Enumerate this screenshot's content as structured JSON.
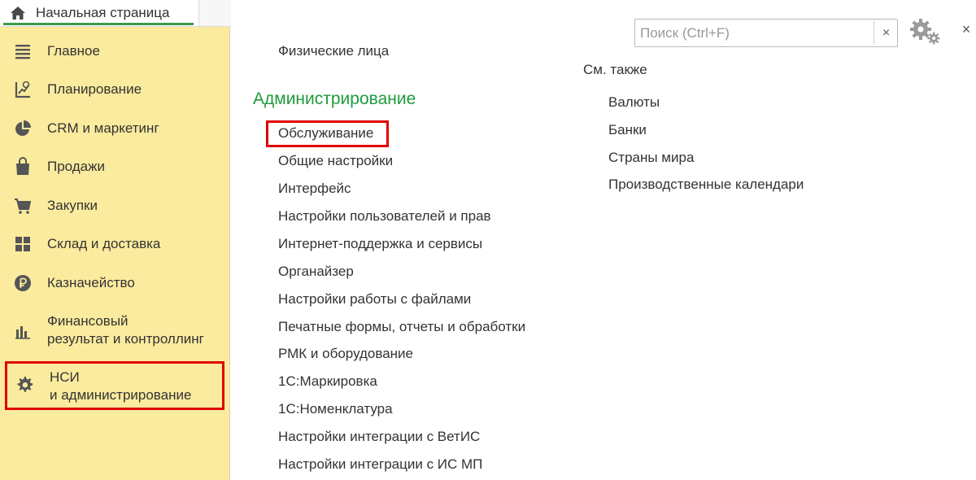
{
  "tab": {
    "home_label": "Начальная страница"
  },
  "sidebar": {
    "items": [
      {
        "label": "Главное",
        "icon": "menu-lines-icon"
      },
      {
        "label": "Планирование",
        "icon": "planning-icon"
      },
      {
        "label": "CRM и маркетинг",
        "icon": "pie-chart-icon"
      },
      {
        "label": "Продажи",
        "icon": "shopping-bag-icon"
      },
      {
        "label": "Закупки",
        "icon": "cart-icon"
      },
      {
        "label": "Склад и доставка",
        "icon": "warehouse-icon"
      },
      {
        "label": "Казначейство",
        "icon": "ruble-coin-icon"
      },
      {
        "label_line1": "Финансовый",
        "label_line2": "результат и контроллинг",
        "icon": "bar-chart-icon"
      },
      {
        "label_line1": "НСИ",
        "label_line2": "и администрирование",
        "icon": "gear-icon",
        "active": true
      }
    ]
  },
  "search": {
    "placeholder": "Поиск (Ctrl+F)",
    "value": "",
    "clear_label": "×"
  },
  "window": {
    "close_label": "×"
  },
  "main": {
    "top_link": "Физические лица",
    "section_title": "Администрирование",
    "admin_links": [
      "Обслуживание",
      "Общие настройки",
      "Интерфейс",
      "Настройки пользователей и прав",
      "Интернет-поддержка и сервисы",
      "Органайзер",
      "Настройки работы с файлами",
      "Печатные формы, отчеты и обработки",
      "РМК и оборудование",
      "1С:Маркировка",
      "1С:Номенклатура",
      "Настройки интеграции с ВетИС",
      "Настройки интеграции с ИС МП"
    ],
    "see_also_title": "См. также",
    "see_also_links": [
      "Валюты",
      "Банки",
      "Страны мира",
      "Производственные календари"
    ]
  },
  "colors": {
    "sidebar_bg": "#fbeb9e",
    "section_title": "#1e9c3c",
    "highlight": "#e00000",
    "tab_underline": "#3c9a4a"
  }
}
